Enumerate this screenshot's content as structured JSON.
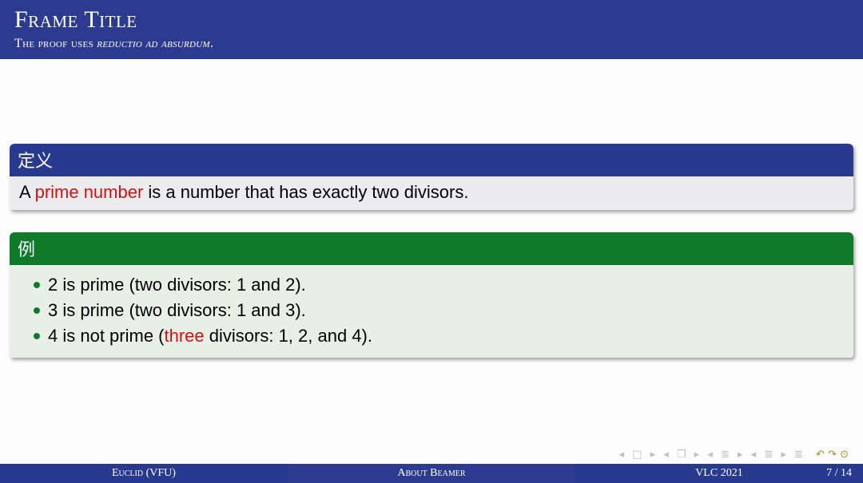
{
  "header": {
    "title": "Frame Title",
    "subtitle_prefix": "The proof uses ",
    "subtitle_ital": "reductio ad absurdum",
    "subtitle_suffix": "."
  },
  "definition": {
    "title": "定义",
    "text_prefix": "A ",
    "text_alert": "prime number",
    "text_suffix": " is a number that has exactly two divisors."
  },
  "example": {
    "title": "例",
    "items": [
      {
        "plain": "2 is prime (two divisors: 1 and 2)."
      },
      {
        "plain": "3 is prime (two divisors: 1 and 3)."
      },
      {
        "prefix": "4 is not prime (",
        "alert": "three",
        "suffix": " divisors: 1, 2, and 4)."
      }
    ]
  },
  "nav": {
    "symbols": "◂ □ ▸   ◂ ❐ ▸   ◂ ≣ ▸   ◂ ≣ ▸    ≣",
    "undo": "↶ ↷ ⊙"
  },
  "footline": {
    "author": "Euclid (VFU)",
    "title": "About Beamer",
    "date": "VLC 2021",
    "page": "7 / 14"
  }
}
